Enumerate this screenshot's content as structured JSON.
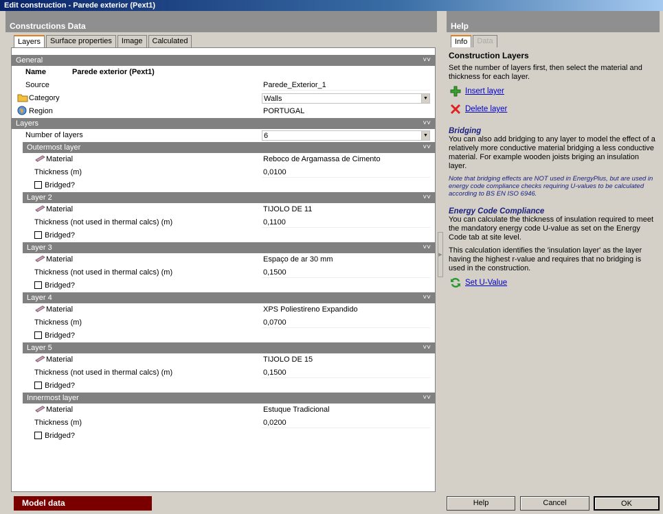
{
  "window": {
    "title": "Edit construction - Parede exterior (Pext1)"
  },
  "left_pane": {
    "title": "Constructions Data",
    "tabs": [
      "Layers",
      "Surface properties",
      "Image",
      "Calculated"
    ],
    "general": {
      "header": "General",
      "name_label": "Name",
      "name_value": "Parede exterior (Pext1)",
      "source_label": "Source",
      "source_value": "Parede_Exterior_1",
      "category_label": "Category",
      "category_value": "Walls",
      "region_label": "Region",
      "region_value": "PORTUGAL"
    },
    "layers": {
      "header": "Layers",
      "count_label": "Number of layers",
      "count_value": "6",
      "items": [
        {
          "header": "Outermost layer",
          "material_label": "Material",
          "material": "Reboco de Argamassa de Cimento",
          "thickness_label": "Thickness (m)",
          "thickness": "0,0100",
          "bridged_label": "Bridged?"
        },
        {
          "header": "Layer 2",
          "material_label": "Material",
          "material": "TIJOLO DE 11",
          "thickness_label": "Thickness (not used in thermal calcs) (m)",
          "thickness": "0,1100",
          "bridged_label": "Bridged?"
        },
        {
          "header": "Layer 3",
          "material_label": "Material",
          "material": "Espaço de ar 30 mm",
          "thickness_label": "Thickness (not used in thermal calcs) (m)",
          "thickness": "0,1500",
          "bridged_label": "Bridged?"
        },
        {
          "header": "Layer 4",
          "material_label": "Material",
          "material": "XPS Poliestireno Expandido",
          "thickness_label": "Thickness (m)",
          "thickness": "0,0700",
          "bridged_label": "Bridged?"
        },
        {
          "header": "Layer 5",
          "material_label": "Material",
          "material": "TIJOLO DE 15",
          "thickness_label": "Thickness (not used in thermal calcs) (m)",
          "thickness": "0,1500",
          "bridged_label": "Bridged?"
        },
        {
          "header": "Innermost layer",
          "material_label": "Material",
          "material": "Estuque Tradicional",
          "thickness_label": "Thickness (m)",
          "thickness": "0,0200",
          "bridged_label": "Bridged?"
        }
      ]
    }
  },
  "help": {
    "title": "Help",
    "tabs": [
      "Info",
      "Data"
    ],
    "heading": "Construction Layers",
    "intro": "Set the number of layers first, then select the material and thickness for each layer.",
    "insert_link": "Insert layer",
    "delete_link": "Delete layer",
    "bridging_title": "Bridging",
    "bridging_text": "You can also add bridging to any layer to model the effect of a relatively more conductive material bridging a less conductive material.  For example wooden joists briging an insulation layer.",
    "bridging_note": "Note that bridging effects are NOT used in EnergyPlus, but are used in energy code compliance checks requiring U-values to be calculated according to BS EN ISO 6946.",
    "ecc_title": "Energy Code Compliance",
    "ecc_text": "You can calculate the thickness of insulation required to meet the mandatory energy code U-value as set on the Energy Code tab at site level.",
    "ecc_text2": "This calculation identifies the 'insulation layer' as the layer having the highest r-value and requires that no bridging is used in the construction.",
    "set_uvalue_link": "Set U-Value"
  },
  "footer": {
    "model_data": "Model data",
    "help_button": "Help",
    "cancel_button": "Cancel",
    "ok_button": "OK"
  },
  "colors": {
    "accent_orange": "#e08020",
    "model_data_bg": "#7a0000",
    "link_blue": "#0000cc"
  }
}
